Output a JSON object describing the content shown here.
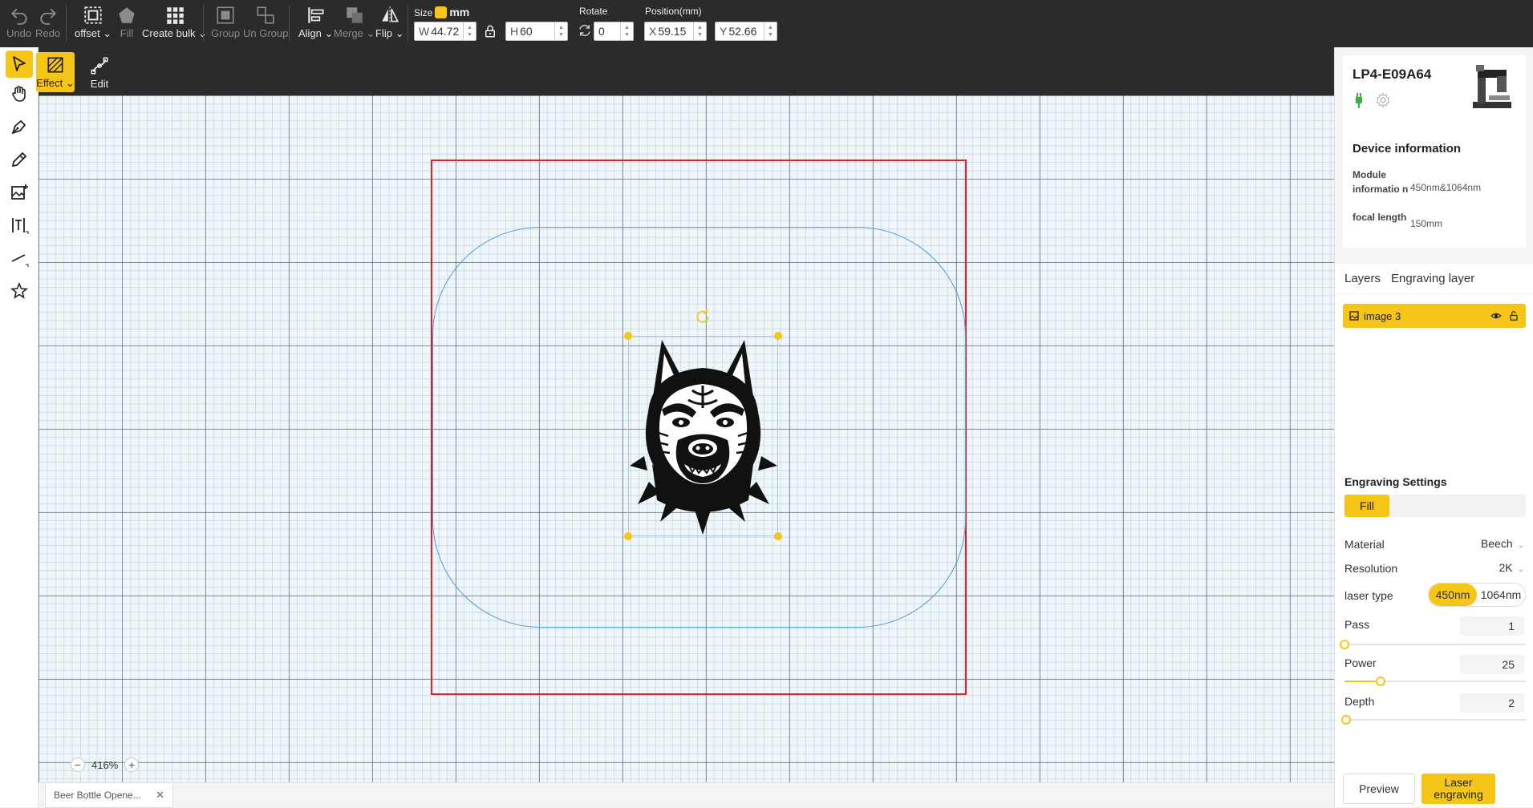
{
  "toolbar": {
    "undo": "Undo",
    "redo": "Redo",
    "offset": "offset",
    "fill": "Fill",
    "create_bulk": "Create bulk",
    "group": "Group",
    "ungroup": "Un Group",
    "align": "Align",
    "merge": "Merge",
    "flip": "Flip",
    "size_label": "Size",
    "size_unit": "mm",
    "width_prefix": "W",
    "width_value": "44.72",
    "height_prefix": "H",
    "height_value": "60",
    "rotate_label": "Rotate",
    "rotate_value": "0",
    "position_label": "Position(mm)",
    "x_prefix": "X",
    "x_value": "59.15",
    "y_prefix": "Y",
    "y_value": "52.66"
  },
  "subtoolbar": {
    "effect": "Effect",
    "edit": "Edit"
  },
  "left_tools": [
    "select-tool",
    "hand-tool",
    "pen-tool",
    "pencil-tool",
    "image-tool",
    "text-tool",
    "line-tool",
    "shape-tool"
  ],
  "canvas": {
    "zoom": "416%",
    "colors": {
      "work_area": "#e0202a",
      "outline": "#4a9ee0",
      "handle": "#f5c518"
    }
  },
  "document_tab": "Beer Bottle Opene...",
  "device": {
    "name": "LP4-E09A64",
    "info_title": "Device information",
    "module_key": "Module informatio n",
    "module_value": "450nm&1064nm",
    "focal_key": "focal length",
    "focal_value": "150mm"
  },
  "tabs": {
    "layers": "Layers",
    "engraving_layer": "Engraving layer"
  },
  "layers": [
    {
      "name": "image 3"
    }
  ],
  "engraving": {
    "title": "Engraving Settings",
    "mode": "Fill",
    "material_label": "Material",
    "material_value": "Beech",
    "resolution_label": "Resolution",
    "resolution_value": "2K",
    "laser_type_label": "laser type",
    "laser_opt1": "450nm",
    "laser_opt2": "1064nm",
    "pass_label": "Pass",
    "pass_value": "1",
    "pass_fraction": 0,
    "power_label": "Power",
    "power_value": "25",
    "power_fraction": 0.2,
    "depth_label": "Depth",
    "depth_value": "2",
    "depth_fraction": 0.01,
    "preview": "Preview",
    "laser_engraving": "Laser engraving"
  },
  "accent_color": "#f5c518"
}
